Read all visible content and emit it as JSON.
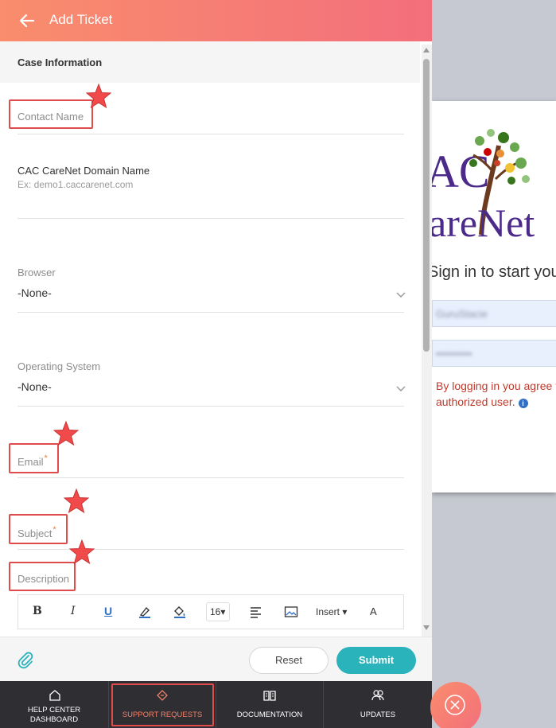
{
  "header": {
    "title": "Add Ticket"
  },
  "form": {
    "section_title": "Case Information",
    "contact_name": {
      "label": "Contact Name"
    },
    "domain": {
      "label": "CAC CareNet Domain Name",
      "hint": "Ex: demo1.caccarenet.com"
    },
    "browser": {
      "label": "Browser",
      "value": "-None-"
    },
    "os": {
      "label": "Operating System",
      "value": "-None-"
    },
    "email": {
      "label": "Email",
      "required": "*"
    },
    "subject": {
      "label": "Subject",
      "required": "*"
    },
    "description": {
      "label": "Description"
    }
  },
  "editor": {
    "bold": "B",
    "italic": "I",
    "underline": "U",
    "font_size": "16",
    "insert": "Insert",
    "font_style": "A"
  },
  "footer": {
    "reset_label": "Reset",
    "submit_label": "Submit"
  },
  "nav": {
    "items": [
      {
        "line1": "HELP CENTER",
        "line2": "DASHBOARD"
      },
      {
        "line1": "SUPPORT REQUESTS"
      },
      {
        "line1": "DOCUMENTATION"
      },
      {
        "line1": "UPDATES"
      }
    ],
    "active_index": 1
  },
  "background": {
    "login_title": "Sign in to start you",
    "username": "GuruStacie",
    "password": "••••••••••",
    "note_line1": "By logging in you agree t",
    "note_line2": "authorized user.",
    "logo_line1": "AC",
    "logo_line2": "areNet"
  },
  "colors": {
    "header_start": "#f98d6c",
    "header_end": "#f36f7c",
    "submit": "#2ab3bb",
    "highlight": "#e04c4c",
    "nav_bg": "#2e2e33",
    "nav_active": "#f0826a"
  }
}
